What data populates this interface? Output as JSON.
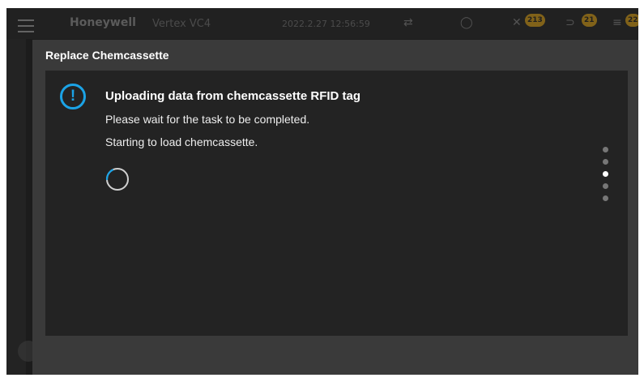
{
  "background_app": {
    "brand": "Honeywell",
    "product": "Vertex VC4",
    "datetime": "2022.2.27 12:56:59",
    "alarm_count": "213",
    "warning_count": "21",
    "fault_count": "22",
    "accent_color": "#e6a817"
  },
  "dialog": {
    "title": "Replace Chemcassette",
    "icon": "info-circle-icon",
    "icon_color": "#1ba3e6",
    "heading": "Uploading data from chemcassette RFID tag",
    "line1": "Please wait for the task to be completed.",
    "line2": "Starting to load chemcassette.",
    "pager": {
      "total": 5,
      "active_index": 2
    }
  }
}
